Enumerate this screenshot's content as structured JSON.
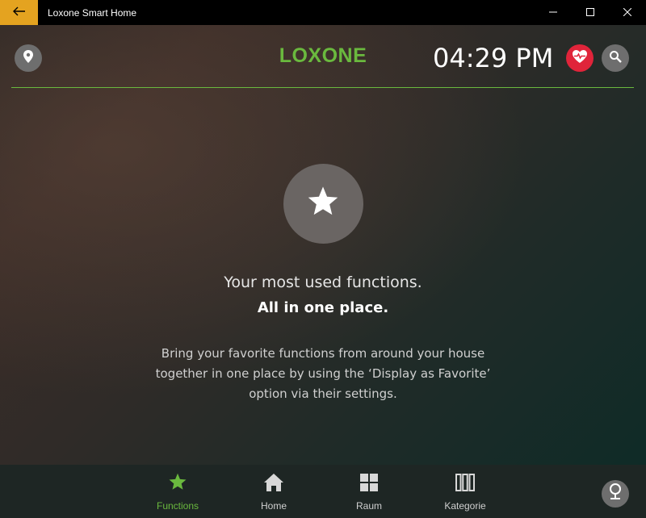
{
  "window": {
    "title": "Loxone Smart Home",
    "back_icon": "arrow-left-icon",
    "controls": [
      "minimize-icon",
      "maximize-icon",
      "close-icon"
    ],
    "back_color": "#e4a320"
  },
  "header": {
    "logo": "LOXONE",
    "time": "04:29 PM",
    "accent_color": "#6ab93e",
    "icons": [
      "location-pin-icon",
      "heart-pulse-icon",
      "search-icon"
    ]
  },
  "empty_state": {
    "icon": "star-icon",
    "headline": "Your most used functions.",
    "subhead": "All in one place.",
    "description": "Bring your favorite functions from around your house together in one place by using the ‘Display as Favorite’ option via their settings."
  },
  "bottom_nav": {
    "items": [
      {
        "label": "Functions",
        "icon": "star-icon",
        "active": true
      },
      {
        "label": "Home",
        "icon": "home-icon",
        "active": false
      },
      {
        "label": "Raum",
        "icon": "grid-icon",
        "active": false
      },
      {
        "label": "Kategorie",
        "icon": "columns-icon",
        "active": false
      }
    ],
    "presence_icon": "presence-pin-icon"
  }
}
